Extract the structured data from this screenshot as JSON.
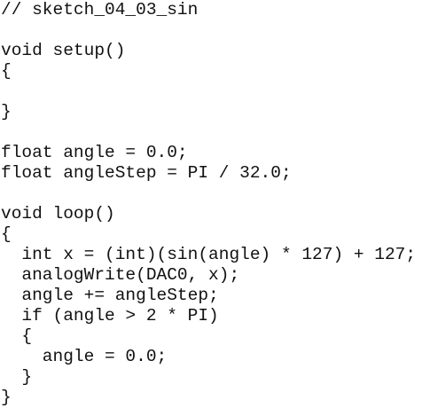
{
  "code": {
    "lines": [
      "// sketch_04_03_sin",
      "",
      "void setup()",
      "{",
      "",
      "}",
      "",
      "float angle = 0.0;",
      "float angleStep = PI / 32.0;",
      "",
      "void loop()",
      "{",
      "  int x = (int)(sin(angle) * 127) + 127;",
      "  analogWrite(DAC0, x);",
      "  angle += angleStep;",
      "  if (angle > 2 * PI)",
      "  {",
      "    angle = 0.0;",
      "  }",
      "}"
    ]
  }
}
